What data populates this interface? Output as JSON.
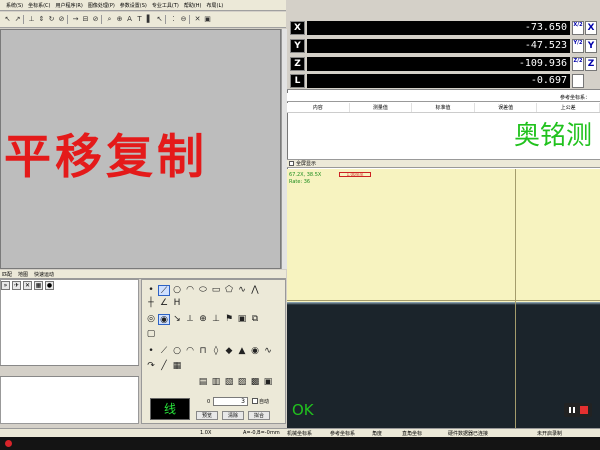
{
  "menu": [
    "系统(S)",
    "坐标系(C)",
    "用户程序(R)",
    "图像处理(P)",
    "参数设置(S)",
    "专业工具(T)",
    "帮助(H)",
    "布局(L)"
  ],
  "toolbar_icons": [
    "pointer-icon",
    "cursor-icon",
    "separator",
    "lock-icon",
    "move-icon",
    "refresh-icon",
    "block-icon",
    "separator",
    "arrow-icon",
    "ruler-icon",
    "slash-icon",
    "separator",
    "magnify-icon",
    "zoom-icon",
    "font-icon",
    "text-icon",
    "bold-icon",
    "pointer-arrow-icon",
    "separator",
    "dots-icon",
    "zoom-out-icon",
    "separator",
    "close-icon",
    "image-icon"
  ],
  "caption": "平移复制",
  "lower_tabs": [
    "匹配",
    "地图",
    "快速运动"
  ],
  "dro": [
    {
      "axis": "X",
      "value": "-73.650",
      "btn_small": "X/2",
      "btn_big": "X"
    },
    {
      "axis": "Y",
      "value": "-47.523",
      "btn_small": "Y/2",
      "btn_big": "Y"
    },
    {
      "axis": "Z",
      "value": "-109.936",
      "btn_small": "Z/2",
      "btn_big": "Z"
    },
    {
      "axis": "L",
      "value": "-0.697"
    }
  ],
  "refbar_label": "参考坐标系：",
  "table_headers": [
    "内容",
    "测量值",
    "标准值",
    "误差值",
    "上公差"
  ],
  "brand": "奥铭测",
  "fullscreen_label": "全屏显示",
  "camera": {
    "info_line1": "67.2X, 38.5X",
    "info_line2": "Rate: 36",
    "scalebar": "1.00mm",
    "ok_text": "OK"
  },
  "controls": {
    "mode_text": "线",
    "zoom_value": "3",
    "auto_label": "自动",
    "btn1": "预览",
    "btn2": "清除",
    "btn3": "拟合",
    "zoom_prefix": "0"
  },
  "status": {
    "zoom": "1.0X",
    "abc": "A=-0,B=-0",
    "unit": "mm",
    "machine": "机械坐标系",
    "ref": "参考坐标系",
    "angle": "角度",
    "linear": "直角坐标",
    "hardware": "硬件数据器已连接",
    "recording": "未开启录制"
  },
  "tool_icons": [
    "point-icon",
    "line-icon",
    "circle-icon",
    "arc-icon",
    "ellipse-icon",
    "rect-icon",
    "slot-icon",
    "curve-icon",
    "polyline-icon",
    "cross-icon",
    "angle-icon",
    "ring-icon",
    "tangent-icon",
    "distance-icon",
    "target-icon",
    "pin-icon",
    "flag-icon",
    "image-icon",
    "copy-icon",
    "fill-icon",
    "auto-point-icon",
    "auto-line-icon",
    "auto-circle-icon",
    "auto-arc-icon",
    "auto-rect-icon",
    "auto-fill-icon",
    "auto-target-icon",
    "auto-polygon-icon",
    "auto-chart-icon",
    "auto-export-icon",
    "auto-barcode-icon",
    "auto-report-icon"
  ]
}
